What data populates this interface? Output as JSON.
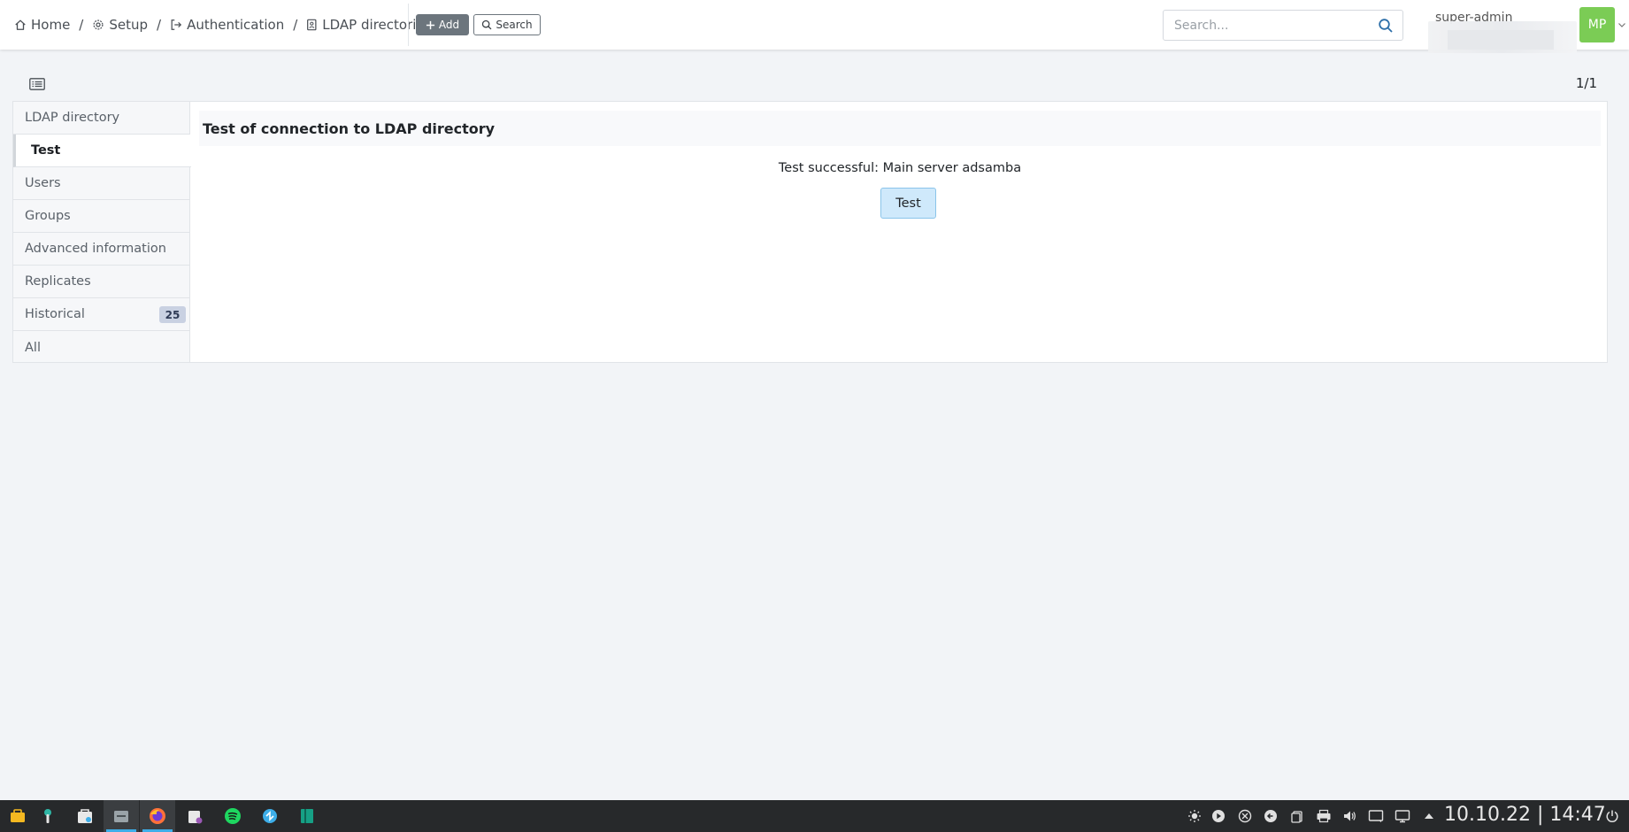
{
  "breadcrumb": {
    "home": "Home",
    "setup": "Setup",
    "authentication": "Authentication",
    "ldap_directories": "LDAP directories",
    "separator": "/"
  },
  "toolbar": {
    "add_label": "Add",
    "search_label": "Search"
  },
  "global_search": {
    "placeholder": "Search..."
  },
  "user": {
    "name": "super-admin",
    "initials": "MP",
    "avatar_color": "#7bcc55"
  },
  "pager": "1/1",
  "sidebar": {
    "items": [
      {
        "label": "LDAP directory"
      },
      {
        "label": "Test",
        "active": true
      },
      {
        "label": "Users"
      },
      {
        "label": "Groups"
      },
      {
        "label": "Advanced information"
      },
      {
        "label": "Replicates"
      },
      {
        "label": "Historical",
        "badge": "25"
      },
      {
        "label": "All"
      }
    ]
  },
  "main": {
    "title": "Test of connection to LDAP directory",
    "result": "Test successful: Main server adsamba",
    "test_button": "Test"
  },
  "taskbar": {
    "clock": "10.10.22 | 14:47",
    "apps": [
      "tools-icon",
      "wrench-icon",
      "store-icon",
      "files-icon",
      "firefox-icon",
      "notes-icon",
      "spotify-icon",
      "remote-icon",
      "book-icon"
    ],
    "tray": [
      "brightness-icon",
      "play-icon",
      "sync-icon",
      "back-icon",
      "clipboard-icon",
      "printer-icon",
      "volume-icon",
      "message-icon",
      "display-icon",
      "arrow-up-icon",
      "power-icon"
    ]
  },
  "colors": {
    "accent": "#3daee9",
    "test_button_bg": "#cfe9fb",
    "badge_bg": "#c9d1e2"
  }
}
